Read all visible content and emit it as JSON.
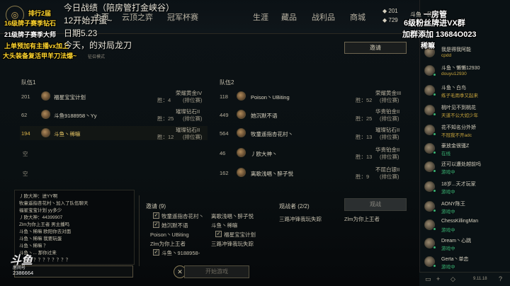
{
  "nav": {
    "tabs": [
      "主页",
      "云顶之弈",
      "冠军杯赛"
    ],
    "right_tabs": [
      "生涯",
      "藏品",
      "战利品",
      "商城"
    ]
  },
  "currency": {
    "rp": "201",
    "be": "729"
  },
  "profile": {
    "name": "斗鱼丶稀嘛"
  },
  "overlays": {
    "tl1": "排行2届",
    "tl2": "16级牌子赛季钻石",
    "tl3": "21级牌子赛季大师",
    "tl4": "上单预加有主播vx加上",
    "tl5": "大头装备复活甲羊刀法爆~",
    "center1": "今日战绩（陪房管打金峡谷）",
    "center2": "12开始开蛋~",
    "center3": "日期5.23",
    "center4": "今天，的对局",
    "center5": "龙刀",
    "right1": "一房管",
    "right2": "6级粉丝牌进VX群",
    "right3": "加群添加 13684O023",
    "right4": "稀嘛"
  },
  "lobby": {
    "invite_label": "邀请",
    "subtitle": "征召模式",
    "team1_label": "队伍1",
    "team2_label": "队伍2",
    "empty_label": "空",
    "team1": [
      {
        "level": "201",
        "name": "福星宝宝计划",
        "rank": "荣耀黄金IV",
        "wins": "胜：4",
        "pos": "(排位赛)"
      },
      {
        "level": "62",
        "name": "斗鱼9188958丶Yy",
        "rank": "璀璨钻石II",
        "wins": "胜：25",
        "pos": "(排位赛)"
      },
      {
        "level": "194",
        "name": "斗鱼丶稀嘛",
        "rank": "璀璨钻石II",
        "wins": "胜：12",
        "pos": "(排位赛)"
      }
    ],
    "team2": [
      {
        "level": "118",
        "name": "Poison丶UBiting",
        "rank": "荣耀黄金III",
        "wins": "胜：52",
        "pos": "(排位赛)"
      },
      {
        "level": "449",
        "name": "她沉默不语",
        "rank": "华贵铂金II",
        "wins": "胜：25",
        "pos": "(排位赛)"
      },
      {
        "level": "564",
        "name": "牧童遥指杏花村丶",
        "rank": "璀璨钻石II",
        "wins": "胜：13",
        "pos": "(排位赛)"
      },
      {
        "level": "46",
        "name": "丿欧大神丶",
        "rank": "华贵铂金II",
        "wins": "胜：13",
        "pos": "(排位赛)"
      },
      {
        "level": "162",
        "name": "离歌浅唱丶醉子悦",
        "rank": "不屈白银II",
        "wins": "胜：9",
        "pos": "(排位赛)"
      }
    ]
  },
  "chat": {
    "lines": [
      "丿欧大神：进YY啊",
      "牧童遥指杏花村丶加入了队伍聊天",
      "福星宝宝计划 yy多少",
      "丿欧大神：44399907",
      "Zlm为你上王者 男主播吗",
      "斗鱼丶稀嘛 欧阳你去对面",
      "斗鱼丶稀嘛 我要玩蛋",
      "斗鱼丶稀嘛 ？",
      "斗鱼丶... 那你过来",
      "...计划 ？？？？？？？？"
    ]
  },
  "invites": {
    "header": "邀请 (9)",
    "col1": [
      "牧童遥指杏花村丶",
      "她沉默不语",
      "Poison丶UBiting",
      "Zlm为你上王者",
      "斗鱼丶9188958-"
    ],
    "col2": [
      "离歌浅唱丶醉子悦",
      "斗鱼丶稀嘛",
      "福星宝宝计划",
      "三路冲锋我玩失踪"
    ]
  },
  "spectators": {
    "header": "观战者 (2/2)",
    "list": [
      "三路冲锋我玩失踪",
      "Zlm为你上王者"
    ],
    "watch_label": "观战"
  },
  "start_label": "开始游戏",
  "friends": [
    {
      "name": "我是得我阿能",
      "status": "cpdd"
    },
    {
      "name": "斗鱼丶懒懒12930",
      "status": "douyu12930"
    },
    {
      "name": "斗鱼丶白鸟",
      "status": "练子毛雨季又起来"
    },
    {
      "name": "桃叶见不到桃花",
      "status": "天道不公大如少年"
    },
    {
      "name": "花不知名分外娇",
      "status": "不冠我不开adc"
    },
    {
      "name": "豪放金很骚Z",
      "status": "在线"
    },
    {
      "name": "还可以遭处越前吗",
      "status": "游戏中"
    },
    {
      "name": "18岁...天才玩家",
      "status": "游戏中"
    },
    {
      "name": "AONY陈王",
      "status": "游戏中"
    },
    {
      "name": "ChessKillingMan",
      "status": "游戏中"
    },
    {
      "name": "Dream丶心跳",
      "status": "游戏中"
    },
    {
      "name": "Gerta丶单恋",
      "status": "游戏中"
    }
  ],
  "stream": {
    "brand": "斗鱼",
    "room_label": "房间号",
    "room_id": "2386664"
  },
  "version": "9.11.18"
}
